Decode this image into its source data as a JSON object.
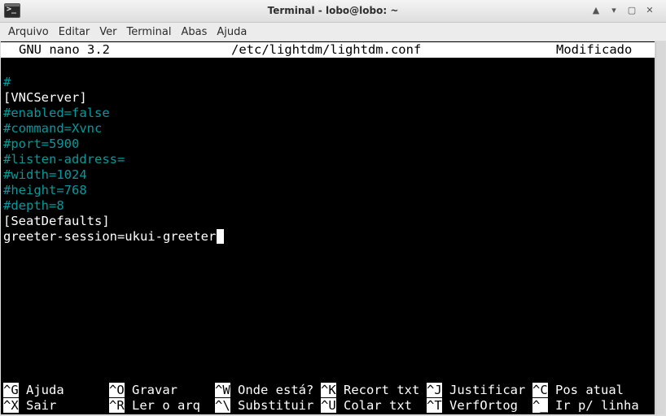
{
  "window": {
    "title": "Terminal - lobo@lobo: ~",
    "icon": "terminal-icon",
    "icon_glyph": ">_",
    "controls": [
      "▲",
      "▾",
      "▢",
      "✕"
    ]
  },
  "menu": [
    "Arquivo",
    "Editar",
    "Ver",
    "Terminal",
    "Abas",
    "Ajuda"
  ],
  "nano": {
    "version": "GNU nano 3.2",
    "file": "/etc/lightdm/lightdm.conf",
    "status": "Modificado"
  },
  "lines": [
    {
      "text": "#",
      "kind": "comment"
    },
    {
      "text": "[VNCServer]",
      "kind": "normal"
    },
    {
      "text": "#enabled=false",
      "kind": "comment"
    },
    {
      "text": "#command=Xvnc",
      "kind": "comment"
    },
    {
      "text": "#port=5900",
      "kind": "comment"
    },
    {
      "text": "#listen-address=",
      "kind": "comment"
    },
    {
      "text": "#width=1024",
      "kind": "comment"
    },
    {
      "text": "#height=768",
      "kind": "comment"
    },
    {
      "text": "#depth=8",
      "kind": "comment"
    },
    {
      "text": "[SeatDefaults]",
      "kind": "normal"
    },
    {
      "text": "greeter-session=ukui-greeter",
      "kind": "normal"
    }
  ],
  "shortcuts": {
    "row1": [
      {
        "key": "^G",
        "label": "Ajuda"
      },
      {
        "key": "^O",
        "label": "Gravar"
      },
      {
        "key": "^W",
        "label": "Onde está?"
      },
      {
        "key": "^K",
        "label": "Recort txt"
      },
      {
        "key": "^J",
        "label": "Justificar"
      },
      {
        "key": "^C",
        "label": "Pos atual"
      }
    ],
    "row2": [
      {
        "key": "^X",
        "label": "Sair"
      },
      {
        "key": "^R",
        "label": "Ler o arq"
      },
      {
        "key": "^\\",
        "label": "Substituir"
      },
      {
        "key": "^U",
        "label": "Colar txt"
      },
      {
        "key": "^T",
        "label": "VerfOrtog"
      },
      {
        "key": "^_",
        "label": "Ir p/ linha"
      }
    ]
  },
  "colors": {
    "comment": "#06989a",
    "terminal_bg": "#000000",
    "text": "#ffffff"
  }
}
